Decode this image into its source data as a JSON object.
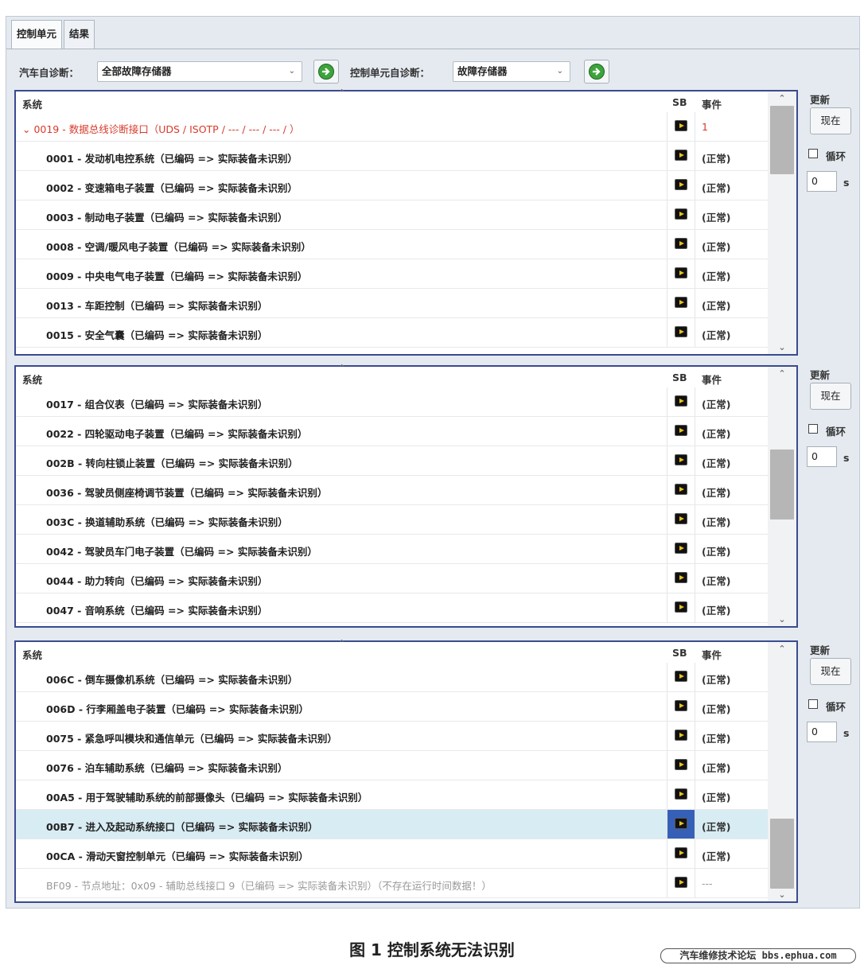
{
  "tabs": [
    {
      "label": "控制单元"
    },
    {
      "label": "结果"
    }
  ],
  "vehicle_diag": {
    "label": "汽车自诊断：",
    "value": "全部故障存储器"
  },
  "unit_diag": {
    "label": "控制单元自诊断：",
    "value": "故障存储器"
  },
  "columns": {
    "system": "系统",
    "sb": "SB",
    "event": "事件"
  },
  "side": {
    "title": "更新",
    "button": "现在",
    "loop": "循环",
    "interval": "0",
    "unit": "s"
  },
  "panel1": {
    "rows": [
      {
        "text": "0019 - 数据总线诊断接口（UDS / ISOTP / --- / --- / --- / ）",
        "event": "1"
      },
      {
        "text": "0001 - 发动机电控系统（已编码 => 实际装备未识别）",
        "event": "(正常)"
      },
      {
        "text": "0002 - 变速箱电子装置（已编码 => 实际装备未识别）",
        "event": "(正常)"
      },
      {
        "text": "0003 - 制动电子装置（已编码 => 实际装备未识别）",
        "event": "(正常)"
      },
      {
        "text": "0008 - 空调/暖风电子装置（已编码 => 实际装备未识别）",
        "event": "(正常)"
      },
      {
        "text": "0009 - 中央电气电子装置（已编码 => 实际装备未识别）",
        "event": "(正常)"
      },
      {
        "text": "0013 - 车距控制（已编码 => 实际装备未识别）",
        "event": "(正常)"
      },
      {
        "text": "0015 - 安全气囊（已编码 => 实际装备未识别）",
        "event": "(正常)"
      }
    ]
  },
  "panel2": {
    "rows": [
      {
        "text": "0017 - 组合仪表（已编码 => 实际装备未识别）",
        "event": "(正常)"
      },
      {
        "text": "0022 - 四轮驱动电子装置（已编码 => 实际装备未识别）",
        "event": "(正常)"
      },
      {
        "text": "002B - 转向柱锁止装置（已编码 => 实际装备未识别）",
        "event": "(正常)"
      },
      {
        "text": "0036 - 驾驶员侧座椅调节装置（已编码 => 实际装备未识别）",
        "event": "(正常)"
      },
      {
        "text": "003C - 换道辅助系统（已编码 => 实际装备未识别）",
        "event": "(正常)"
      },
      {
        "text": "0042 - 驾驶员车门电子装置（已编码 => 实际装备未识别）",
        "event": "(正常)"
      },
      {
        "text": "0044 - 助力转向（已编码 => 实际装备未识别）",
        "event": "(正常)"
      },
      {
        "text": "0047 - 音响系统（已编码 => 实际装备未识别）",
        "event": "(正常)"
      }
    ]
  },
  "panel3": {
    "rows": [
      {
        "text": "006C - 倒车摄像机系统（已编码 => 实际装备未识别）",
        "event": "(正常)"
      },
      {
        "text": "006D - 行李厢盖电子装置（已编码 => 实际装备未识别）",
        "event": "(正常)"
      },
      {
        "text": "0075 - 紧急呼叫模块和通信单元（已编码 => 实际装备未识别）",
        "event": "(正常)"
      },
      {
        "text": "0076 - 泊车辅助系统（已编码 => 实际装备未识别）",
        "event": "(正常)"
      },
      {
        "text": "00A5 - 用于驾驶辅助系统的前部摄像头（已编码 => 实际装备未识别）",
        "event": "(正常)"
      },
      {
        "text": "00B7 - 进入及起动系统接口（已编码 => 实际装备未识别）",
        "event": "(正常)"
      },
      {
        "text": "00CA - 滑动天窗控制单元（已编码 => 实际装备未识别）",
        "event": "(正常)"
      },
      {
        "text": "BF09 - 节点地址：0x09 - 辅助总线接口 9（已编码 => 实际装备未识别）（不存在运行时间数据！）",
        "event": "---"
      }
    ]
  },
  "caption": "图 1 控制系统无法识别",
  "watermark": "汽车维修技术论坛 bbs.ephua.com"
}
